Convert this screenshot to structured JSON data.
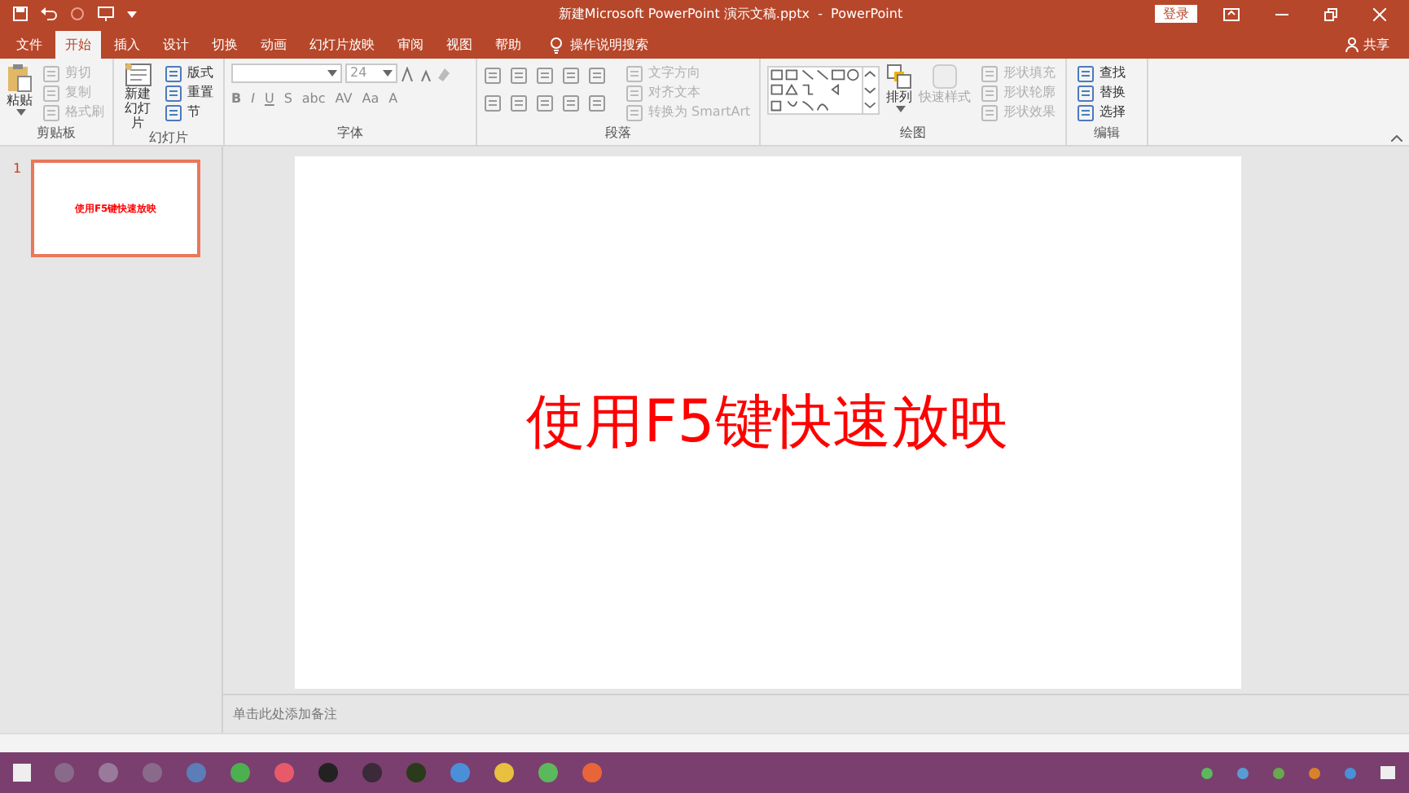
{
  "title_bar": {
    "title": "新建Microsoft PowerPoint 演示文稿.pptx  -  PowerPoint",
    "login": "登录"
  },
  "tabs": [
    {
      "label": "文件",
      "selected": false
    },
    {
      "label": "开始",
      "selected": true
    },
    {
      "label": "插入",
      "selected": false
    },
    {
      "label": "设计",
      "selected": false
    },
    {
      "label": "切换",
      "selected": false
    },
    {
      "label": "动画",
      "selected": false
    },
    {
      "label": "幻灯片放映",
      "selected": false
    },
    {
      "label": "审阅",
      "selected": false
    },
    {
      "label": "视图",
      "selected": false
    },
    {
      "label": "帮助",
      "selected": false
    }
  ],
  "tell_me": "操作说明搜索",
  "share": "共享",
  "ribbon": {
    "clipboard": {
      "label": "剪贴板",
      "paste": "粘贴",
      "small": [
        {
          "label": "剪切",
          "disabled": true
        },
        {
          "label": "复制",
          "disabled": true
        },
        {
          "label": "格式刷",
          "disabled": true
        }
      ]
    },
    "slides": {
      "label": "幻灯片",
      "new_slide": "新建幻灯片",
      "small": [
        {
          "label": "版式",
          "disabled": false
        },
        {
          "label": "重置",
          "disabled": false
        },
        {
          "label": "节",
          "disabled": false
        }
      ]
    },
    "font": {
      "label": "字体",
      "size": "24",
      "format_buttons": [
        "B",
        "I",
        "U",
        "S",
        "abc",
        "AV",
        "Aa",
        "A"
      ]
    },
    "paragraph": {
      "label": "段落",
      "small": [
        {
          "label": "文字方向",
          "disabled": true
        },
        {
          "label": "对齐文本",
          "disabled": true
        },
        {
          "label": "转换为 SmartArt",
          "disabled": true
        }
      ]
    },
    "drawing": {
      "label": "绘图",
      "arrange": "排列",
      "quick_styles": "快速样式",
      "small": [
        {
          "label": "形状填充",
          "disabled": true
        },
        {
          "label": "形状轮廓",
          "disabled": true
        },
        {
          "label": "形状效果",
          "disabled": true
        }
      ]
    },
    "editing": {
      "label": "编辑",
      "small": [
        {
          "label": "查找"
        },
        {
          "label": "替换"
        },
        {
          "label": "选择"
        }
      ]
    }
  },
  "slides": [
    {
      "number": "1",
      "title": "使用F5键快速放映",
      "selected": true
    }
  ],
  "slide": {
    "title": "使用F5键快速放映"
  },
  "notes": {
    "placeholder": "单击此处添加备注"
  }
}
